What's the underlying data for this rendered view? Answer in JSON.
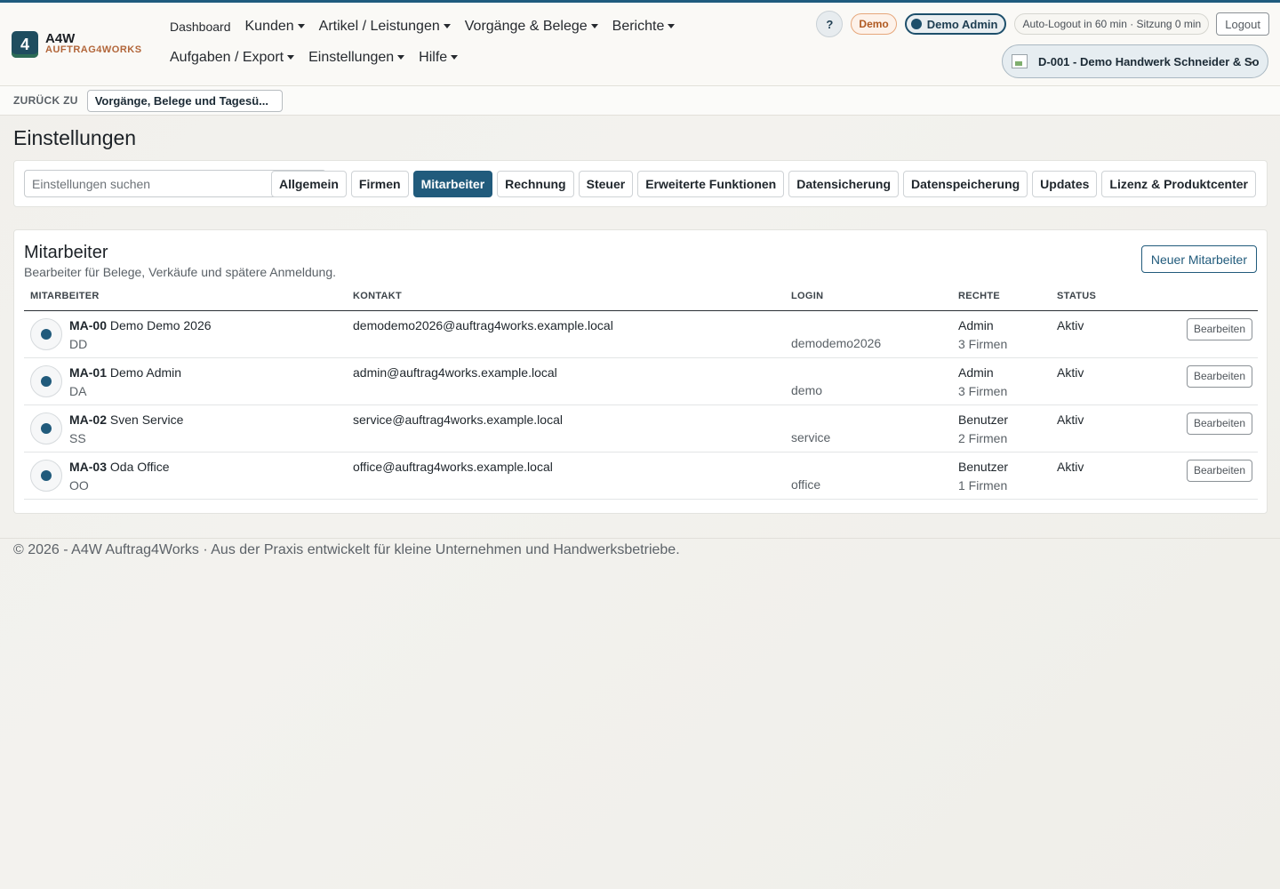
{
  "brand": {
    "logo": "4",
    "name": "A4W",
    "sub": "AUFTRAG4WORKS"
  },
  "nav": {
    "row1": [
      {
        "label": "Dashboard",
        "caret": false,
        "small": true
      },
      {
        "label": "Kunden",
        "caret": true
      },
      {
        "label": "Artikel / Leistungen",
        "caret": true
      },
      {
        "label": "Vorgänge & Belege",
        "caret": true
      },
      {
        "label": "Berichte",
        "caret": true
      }
    ],
    "row2": [
      {
        "label": "Aufgaben / Export",
        "caret": true
      },
      {
        "label": "Einstellungen",
        "caret": true
      },
      {
        "label": "Hilfe",
        "caret": true
      }
    ]
  },
  "topbar": {
    "help": "?",
    "demo_badge": "Demo",
    "user": "Demo Admin",
    "autologout": "Auto-Logout in 60 min · Sitzung 0 min",
    "logout": "Logout",
    "company": "D-001 - Demo Handwerk Schneider & So"
  },
  "back": {
    "label": "ZURÜCK ZU",
    "target": "Vorgänge, Belege und Tagesü..."
  },
  "page": {
    "title": "Einstellungen"
  },
  "settings": {
    "search_placeholder": "Einstellungen suchen",
    "tabs": [
      {
        "label": "Allgemein",
        "active": false
      },
      {
        "label": "Firmen",
        "active": false
      },
      {
        "label": "Mitarbeiter",
        "active": true
      },
      {
        "label": "Rechnung",
        "active": false
      },
      {
        "label": "Steuer",
        "active": false
      },
      {
        "label": "Erweiterte Funktionen",
        "active": false
      },
      {
        "label": "Datensicherung",
        "active": false
      },
      {
        "label": "Datenspeicherung",
        "active": false
      },
      {
        "label": "Updates",
        "active": false
      },
      {
        "label": "Lizenz & Produktcenter",
        "active": false
      }
    ]
  },
  "staff": {
    "title": "Mitarbeiter",
    "subtitle": "Bearbeiter für Belege, Verkäufe und spätere Anmeldung.",
    "new_button": "Neuer Mitarbeiter",
    "columns": [
      "MITARBEITER",
      "KONTAKT",
      "LOGIN",
      "RECHTE",
      "STATUS"
    ],
    "rows": [
      {
        "id": "MA-00",
        "name": "Demo Demo 2026",
        "initials": "DD",
        "email": "demodemo2026@auftrag4works.example.local",
        "login": "demodemo2026",
        "role": "Admin",
        "companies": "3 Firmen",
        "status": "Aktiv",
        "action": "Bearbeiten"
      },
      {
        "id": "MA-01",
        "name": "Demo Admin",
        "initials": "DA",
        "email": "admin@auftrag4works.example.local",
        "login": "demo",
        "role": "Admin",
        "companies": "3 Firmen",
        "status": "Aktiv",
        "action": "Bearbeiten"
      },
      {
        "id": "MA-02",
        "name": "Sven Service",
        "initials": "SS",
        "email": "service@auftrag4works.example.local",
        "login": "service",
        "role": "Benutzer",
        "companies": "2 Firmen",
        "status": "Aktiv",
        "action": "Bearbeiten"
      },
      {
        "id": "MA-03",
        "name": "Oda Office",
        "initials": "OO",
        "email": "office@auftrag4works.example.local",
        "login": "office",
        "role": "Benutzer",
        "companies": "1 Firmen",
        "status": "Aktiv",
        "action": "Bearbeiten"
      }
    ]
  },
  "footer": {
    "text": "© 2026 - A4W Auftrag4Works · Aus der Praxis entwickelt für kleine Unternehmen und Handwerksbetriebe."
  },
  "colors": {
    "primary": "#215b7c",
    "accent": "#b2663a",
    "demo": "#b05a22"
  }
}
